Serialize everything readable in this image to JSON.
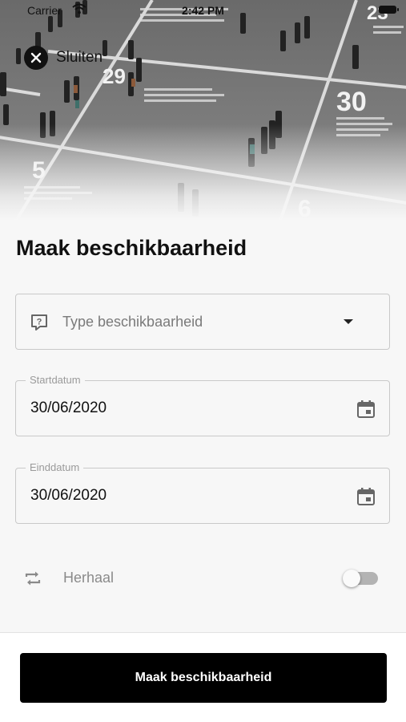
{
  "status_bar": {
    "carrier": "Carrier",
    "time": "2:42 PM"
  },
  "header": {
    "close_label": "Sluiten",
    "close_icon": "close-icon"
  },
  "hero_numbers": [
    "29",
    "30",
    "5",
    "23",
    "6"
  ],
  "page": {
    "title": "Maak beschikbaarheid"
  },
  "type_field": {
    "placeholder": "Type beschikbaarheid",
    "icon": "help-bubble-icon"
  },
  "start_field": {
    "label": "Startdatum",
    "value": "30/06/2020",
    "icon": "calendar-icon"
  },
  "end_field": {
    "label": "Einddatum",
    "value": "30/06/2020",
    "icon": "calendar-icon"
  },
  "repeat": {
    "label": "Herhaal",
    "enabled": false,
    "icon": "repeat-icon"
  },
  "footer": {
    "submit_label": "Maak beschikbaarheid"
  },
  "colors": {
    "primary": "#000000",
    "background": "#f7f7f7",
    "border": "#c9c9c9",
    "muted_text": "#8a8a8a"
  }
}
